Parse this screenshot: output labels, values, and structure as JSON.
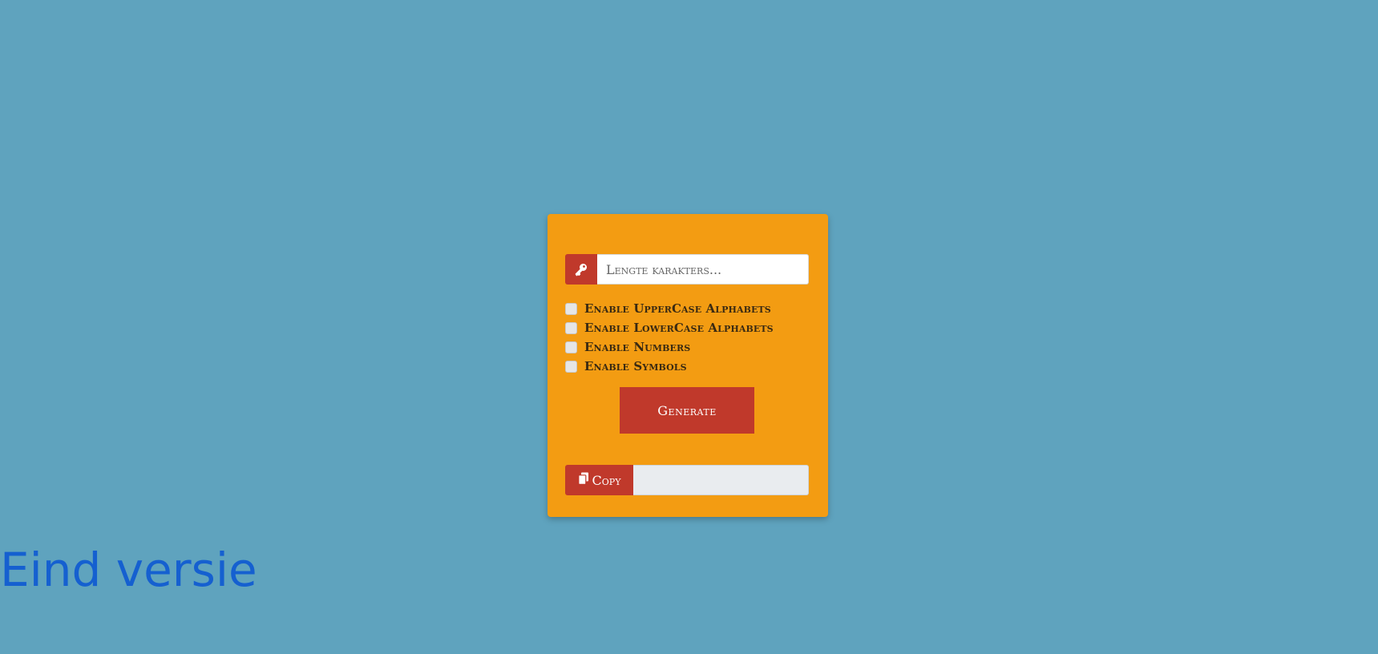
{
  "card": {
    "length_input": {
      "placeholder": "Lengte karakters...",
      "value": ""
    },
    "options": [
      {
        "label": "Enable UpperCase Alphabets",
        "checked": false
      },
      {
        "label": "Enable LowerCase Alphabets",
        "checked": false
      },
      {
        "label": "Enable Numbers",
        "checked": false
      },
      {
        "label": "Enable Symbols",
        "checked": false
      }
    ],
    "generate_label": "Generate",
    "copy_label": "Copy",
    "output_value": ""
  },
  "footer": {
    "title": "Eind versie"
  },
  "colors": {
    "background": "#5fa3be",
    "card": "#f39c12",
    "accent": "#c0392b",
    "title": "#1560d0"
  },
  "icons": {
    "length": "key-icon",
    "copy": "copy-icon"
  }
}
